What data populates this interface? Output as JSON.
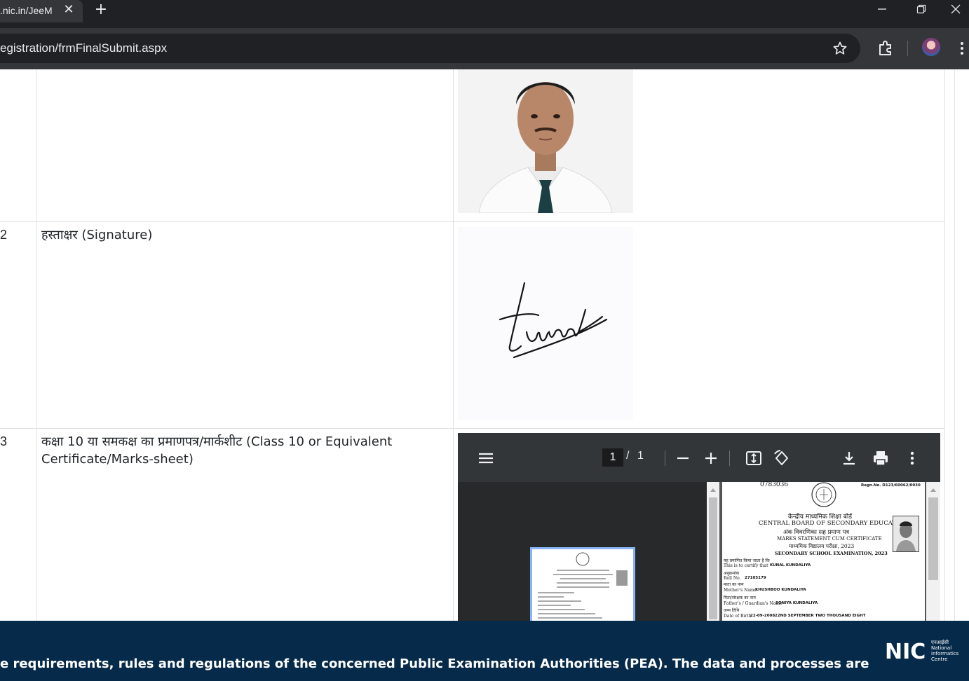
{
  "browser": {
    "tab_title": ".nic.in/JeeM",
    "tab_close": "✕",
    "new_tab": "+",
    "url": "egistration/frmFinalSubmit.aspx",
    "window_controls": [
      "minimize-icon",
      "restore-icon",
      "close-icon"
    ]
  },
  "table": {
    "rows": [
      {
        "number": "2",
        "label": "हस्ताक्षर (Signature)"
      },
      {
        "number": "3",
        "label": "कक्षा 10 या समकक्ष का प्रमाणपत्र/मार्कशीट (Class 10 or Equivalent Certificate/Marks-sheet)"
      }
    ],
    "signature_text": "Kunal"
  },
  "pdf_viewer": {
    "current_page": "1",
    "separator": "/",
    "total_pages": "1",
    "icons": [
      "menu-icon",
      "zoom-out-icon",
      "zoom-in-icon",
      "fit-page-icon",
      "rotate-icon",
      "download-icon",
      "print-icon",
      "more-icon"
    ],
    "document": {
      "serial": "0783036",
      "regn": "Regn.No.  D123/60062/0030",
      "board_hi": "केन्द्रीय माध्यमिक शिक्षा बोर्ड",
      "board_en": "CENTRAL BOARD OF SECONDARY EDUCATION",
      "cert_hi": "अंक विवरणिका सह प्रमाण पत्र",
      "cert_en": "MARKS STATEMENT CUM CERTIFICATE",
      "exam_hi": "माध्यमिक विद्यालय परीक्षा, 2023",
      "exam_en": "SECONDARY SCHOOL EXAMINATION, 2023",
      "certify_hi": "यह प्रमाणित किया जाता है कि",
      "certify_en": "This is to certify that",
      "student": "KUNAL KUNDALIYA",
      "roll_hi": "अनुक्रमांक",
      "roll_label": "Roll No.",
      "roll_no": "27105179",
      "mother_hi": "माता का नाम",
      "mother_label": "Mother's Name",
      "mother_name": "KHUSHBOO KUNDALIYA",
      "father_hi": "पिता/संरक्षक का नाम",
      "father_label": "Father's / Guardian's Name",
      "father_name": "SONIYA KUNDALIYA",
      "dob_hi": "जन्म तिथि",
      "dob_label": "Date of Birth",
      "dob": "22-09-2008",
      "dob_words": "22ND SEPTEMBER TWO THOUSAND EIGHT"
    }
  },
  "footer": {
    "text": "e requirements, rules and regulations of the concerned Public Examination Authorities (PEA). The data and processes are",
    "logo_text": "NIC",
    "logo_hi": "एनआईसी",
    "logo_lines": [
      "National",
      "Informatics",
      "Centre"
    ]
  },
  "colors": {
    "footer_bg": "#052a4a",
    "chrome_dark": "#202124",
    "chrome_toolbar": "#35363a",
    "pdf_toolbar": "#323639"
  }
}
